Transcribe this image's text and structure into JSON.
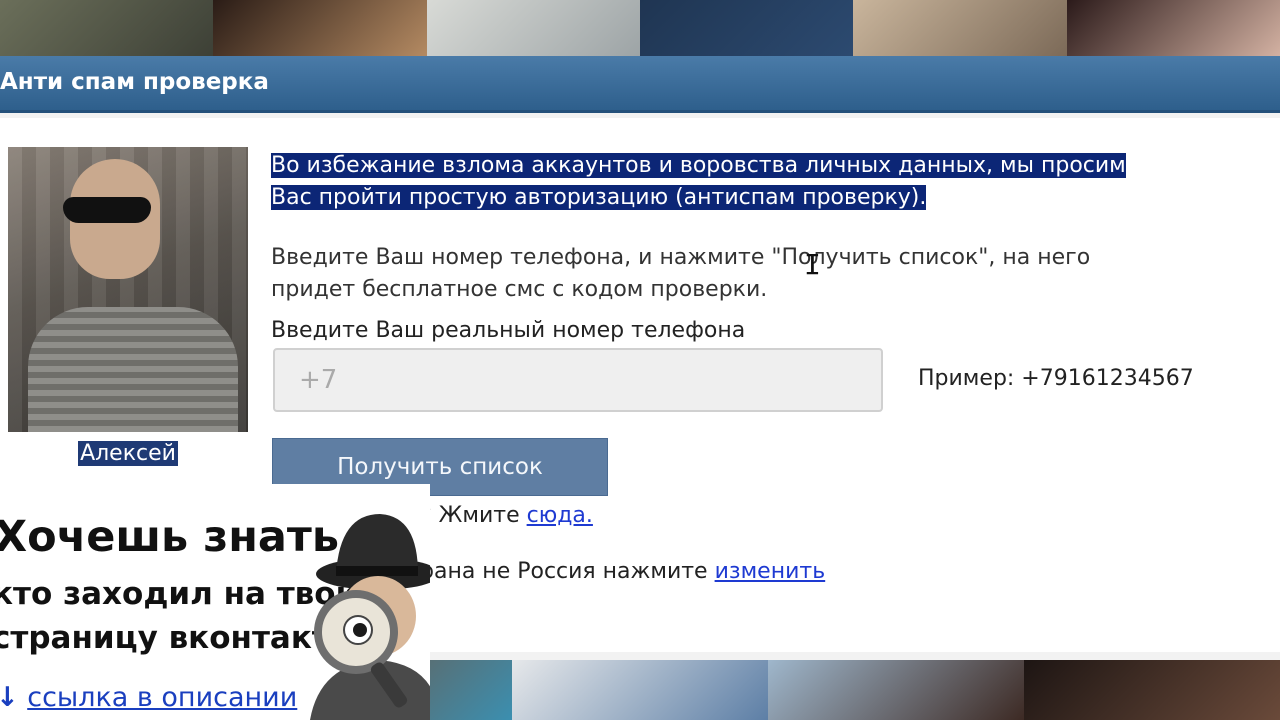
{
  "dialog": {
    "title": "Анти спам проверка"
  },
  "profile": {
    "name": "Алексей"
  },
  "intro": {
    "line1": "Во избежание взлома аккаунтов и воровства личных данных, мы просим",
    "line2": "Вас пройти простую авторизацию (антиспам проверку)."
  },
  "instruction": {
    "line1": "Введите Ваш номер телефона, и нажмите \"Получить список\", на него",
    "line2": "придет бесплатное смс с кодом проверки."
  },
  "phone": {
    "label": "Введите Ваш реальный номер телефона",
    "placeholder": "+7",
    "example": "Пример: +79161234567"
  },
  "actions": {
    "get_list": "Получить список"
  },
  "help": {
    "prefix": "? Жмите ",
    "link": "сюда."
  },
  "country": {
    "prefix": "рана не Россия нажмите ",
    "link": "изменить"
  },
  "ad": {
    "headline": "Хочешь знать",
    "line1": "кто заходил на твою",
    "line2": "страницу вконтакте?",
    "arrow": "↓",
    "link": "ссылка в описании"
  },
  "colors": {
    "titlebar": "#2e5f8c",
    "selection": "#0c2676",
    "button": "#5f7ea3",
    "link": "#1e3ad2"
  }
}
